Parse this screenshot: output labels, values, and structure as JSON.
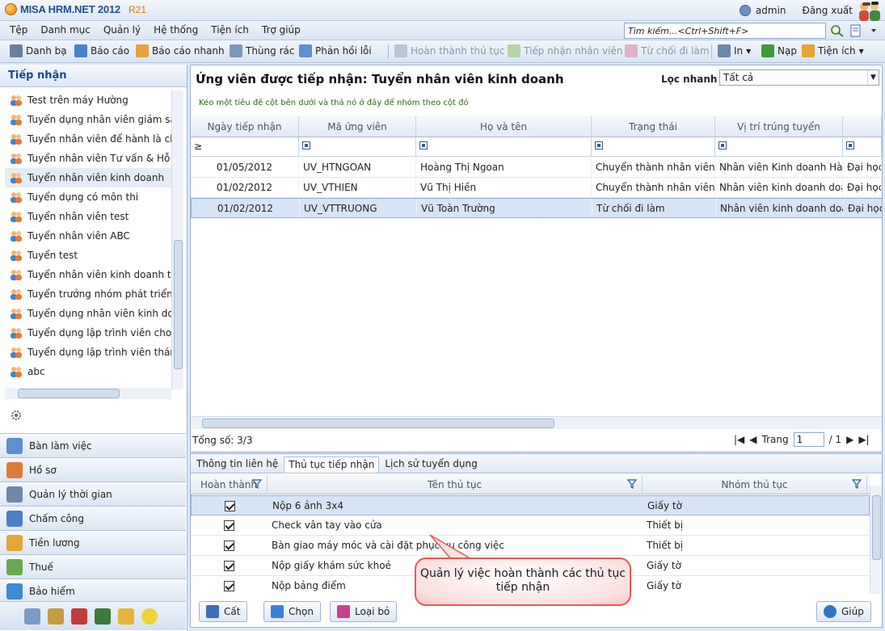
{
  "app": {
    "name": "MISA HRM.NET 2012",
    "version": "R21",
    "user": "admin",
    "logout": "Đăng xuất"
  },
  "menu": [
    "Tệp",
    "Danh mục",
    "Quản lý",
    "Hệ thống",
    "Tiện ích",
    "Trợ giúp"
  ],
  "search": {
    "placeholder": "Tìm kiếm...<Ctrl+Shift+F>"
  },
  "toolbar": {
    "danh_ba": "Danh bạ",
    "bao_cao": "Báo cáo",
    "bao_cao_nhanh": "Báo cáo nhanh",
    "thung_rac": "Thùng rác",
    "phan_hoi_loi": "Phản hồi lỗi",
    "hoan_thanh": "Hoàn thành thủ tục",
    "tiep_nhan_nv": "Tiếp nhận nhân viên",
    "tu_choi": "Từ chối đi làm",
    "in": "In",
    "nap": "Nạp",
    "tien_ich": "Tiện ích"
  },
  "left": {
    "header": "Tiếp nhận",
    "items": [
      "Test trên máy Hường",
      "Tuyển dụng nhân viên giám sát c",
      "Tuyển nhân viên để hành là chín",
      "Tuyển nhân viên Tư vấn & Hỗ trợ",
      "Tuyển nhân viên kinh doanh",
      "Tuyển dụng có môn thi",
      "Tuyển nhân viên test",
      "Tuyển nhân viên ABC",
      "Tuyển test",
      "Tuyển nhân viên kinh doanh thá",
      "Tuyển trưởng nhóm phát triển ki",
      "Tuyển dụng nhân viên kinh doan",
      "Tuyển dụng lập trình viên cho TT",
      "Tuyển dụng lập trình viên tháng",
      "abc"
    ],
    "selected_index": 4,
    "nav": [
      "Bàn làm việc",
      "Hồ sơ",
      "Quản lý thời gian",
      "Chấm công",
      "Tiền lương",
      "Thuế",
      "Bảo hiểm"
    ]
  },
  "main": {
    "title": "Ứng viên được tiếp nhận: Tuyển nhân viên kinh doanh",
    "quick_filter_label": "Lọc nhanh",
    "quick_filter_value": "Tất cả",
    "group_hint": "Kéo một tiêu đề cột bên dưới và thả nó ở đây để nhóm theo cột đó",
    "columns": [
      "Ngày tiếp nhận",
      "Mã ứng viên",
      "Họ và tên",
      "Trạng thái",
      "Vị trí trúng tuyển",
      ""
    ],
    "filter_first": "≥",
    "rows": [
      [
        "01/05/2012",
        "UV_HTNGOAN",
        "Hoàng Thị Ngoan",
        "Chuyển thành nhân viên",
        "Nhân viên Kinh doanh Hành",
        "Đại học"
      ],
      [
        "01/02/2012",
        "UV_VTHIEN",
        "Vũ Thị Hiền",
        "Chuyển thành nhân viên",
        "Nhân viên kinh doanh doan",
        "Đại học"
      ],
      [
        "01/02/2012",
        "UV_VTTRUONG",
        "Vũ Toàn Trường",
        "Từ chối đi làm",
        "Nhân viên kinh doanh doan",
        "Đại học"
      ]
    ],
    "selected_row": 2,
    "total": "Tổng số: 3/3",
    "page_label": "Trang",
    "page_value": "1",
    "page_total": "/ 1"
  },
  "bottom": {
    "tabs": [
      "Thông tin liên hệ",
      "Thủ tục tiếp nhận",
      "Lịch sử tuyển dụng"
    ],
    "active_tab": 1,
    "columns": [
      "Hoàn thành",
      "Tên thủ tục",
      "Nhóm thủ tục"
    ],
    "rows": [
      {
        "done": true,
        "name": "Nộp 6 ảnh 3x4",
        "group": "Giấy tờ"
      },
      {
        "done": true,
        "name": "Check vân tay vào cửa",
        "group": "Thiết bị"
      },
      {
        "done": true,
        "name": "Bàn giao máy móc và cài đặt phục vụ công việc",
        "group": "Thiết bị"
      },
      {
        "done": true,
        "name": "Nộp giấy khám sức khoẻ",
        "group": "Giấy tờ"
      },
      {
        "done": true,
        "name": "Nộp bảng điểm",
        "group": "Giấy tờ"
      }
    ],
    "buttons": {
      "save": "Cất",
      "choose": "Chọn",
      "remove": "Loại bỏ",
      "help": "Giúp"
    }
  },
  "callout": {
    "text": "Quản lý việc hoàn thành các thủ tục tiếp nhận"
  }
}
